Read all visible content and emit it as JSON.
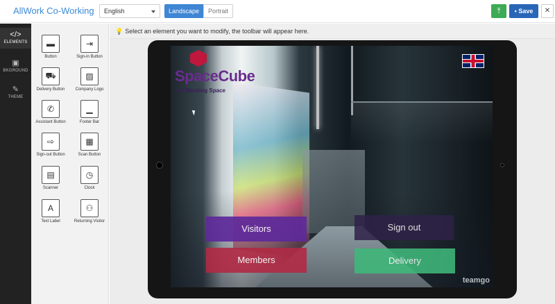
{
  "header": {
    "app_title": "AllWork Co-Working",
    "language": "English",
    "orientation_landscape": "Landscape",
    "orientation_portrait": "Portrait",
    "upload_icon": "upload-icon",
    "save_label": "Save",
    "close_symbol": "✕",
    "active_orientation": "Landscape"
  },
  "rail": [
    {
      "label": "ELEMENTS",
      "icon": "</>"
    },
    {
      "label": "BKGROUND",
      "icon": "▣"
    },
    {
      "label": "THEME",
      "icon": "✎"
    }
  ],
  "palette": {
    "tools": [
      {
        "label": "Button",
        "icon": "▬"
      },
      {
        "label": "Sign-in Button",
        "icon": "⇥"
      },
      {
        "label": "Delivery Button",
        "icon": "⛟"
      },
      {
        "label": "Company Logo",
        "icon": "▨"
      },
      {
        "label": "Assistant Button",
        "icon": "✆"
      },
      {
        "label": "Footer Bar",
        "icon": "▁"
      },
      {
        "label": "Sign-out Button",
        "icon": "⇨"
      },
      {
        "label": "Scan Button",
        "icon": "▦"
      },
      {
        "label": "Scanner",
        "icon": "▤"
      },
      {
        "label": "Clock",
        "icon": "◷"
      },
      {
        "label": "Text Label",
        "icon": "A"
      },
      {
        "label": "Returning Visitor",
        "icon": "⚇"
      }
    ]
  },
  "canvas": {
    "hint": "Select an element you want to modify, the toolbar will appear here.",
    "logo_title": "SpaceCube",
    "logo_subtitle": "Co-Working Space",
    "buttons": {
      "visitors": "Visitors",
      "sign_out": "Sign out",
      "members": "Members",
      "delivery": "Delivery"
    },
    "watermark": "teamgo"
  },
  "colors": {
    "accent": "#3f86d4",
    "save": "#2a66b8",
    "upload": "#3daa55",
    "visitors": "#5e2a9a",
    "members": "#b12a44",
    "delivery": "#3fb87a"
  }
}
